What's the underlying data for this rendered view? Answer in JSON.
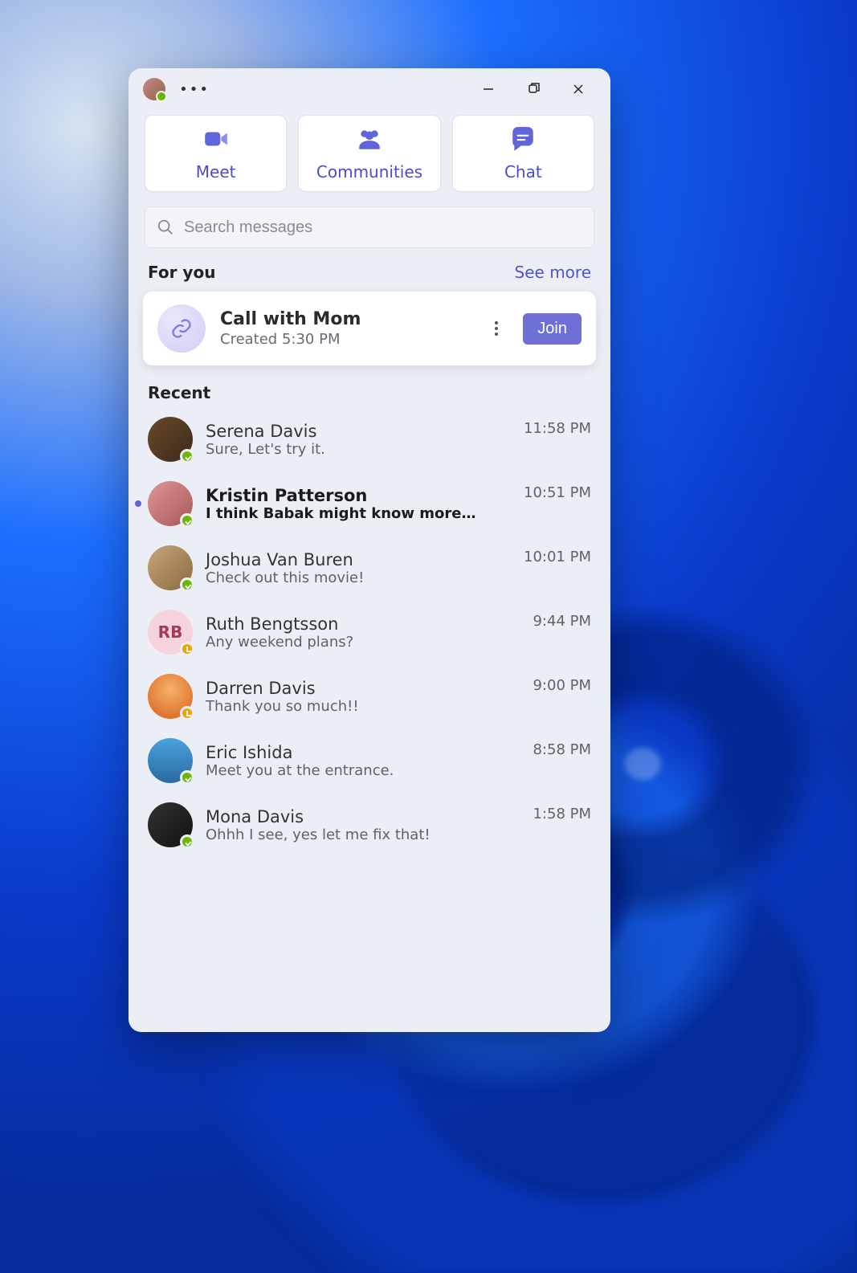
{
  "actions": {
    "meet": "Meet",
    "communities": "Communities",
    "chat": "Chat"
  },
  "search": {
    "placeholder": "Search messages"
  },
  "for_you": {
    "header": "For you",
    "see_more": "See more",
    "card": {
      "title": "Call with Mom",
      "subtitle": "Created 5:30 PM",
      "join": "Join"
    }
  },
  "recent": {
    "header": "Recent",
    "items": [
      {
        "name": "Serena Davis",
        "preview": "Sure, Let's try it.",
        "time": "11:58 PM",
        "unread": false,
        "presence": "available",
        "initials": "",
        "bg": "linear-gradient(135deg,#6b4a2a,#3a2a1a)"
      },
      {
        "name": "Kristin Patterson",
        "preview": "I think Babak might know more a…",
        "time": "10:51 PM",
        "unread": true,
        "presence": "available",
        "initials": "",
        "bg": "linear-gradient(135deg,#d99,#a55)"
      },
      {
        "name": "Joshua Van Buren",
        "preview": "Check out this movie!",
        "time": "10:01 PM",
        "unread": false,
        "presence": "available",
        "initials": "",
        "bg": "linear-gradient(135deg,#c7a67a,#8a6a40)"
      },
      {
        "name": "Ruth Bengtsson",
        "preview": "Any weekend plans?",
        "time": "9:44 PM",
        "unread": false,
        "presence": "away",
        "initials": "RB",
        "bg": "#f6d2dd"
      },
      {
        "name": "Darren Davis",
        "preview": "Thank you so much!!",
        "time": "9:00 PM",
        "unread": false,
        "presence": "away",
        "initials": "",
        "bg": "radial-gradient(circle at 50% 35%,#f7b06a,#d6601a)"
      },
      {
        "name": "Eric Ishida",
        "preview": "Meet you at the entrance.",
        "time": "8:58 PM",
        "unread": false,
        "presence": "available",
        "initials": "",
        "bg": "linear-gradient(180deg,#4aa3e0,#2a6aa0)"
      },
      {
        "name": "Mona Davis",
        "preview": "Ohhh I see, yes let me fix that!",
        "time": "1:58 PM",
        "unread": false,
        "presence": "available",
        "initials": "",
        "bg": "linear-gradient(135deg,#333,#111)"
      }
    ]
  }
}
